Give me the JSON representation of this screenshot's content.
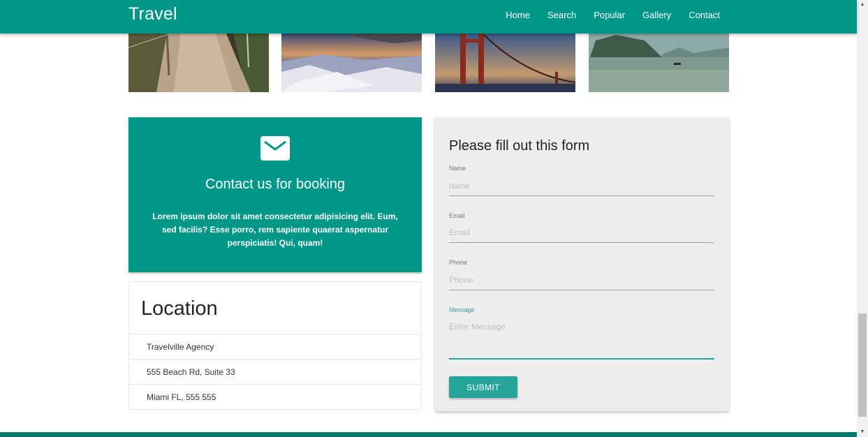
{
  "navbar": {
    "brand": "Travel",
    "links": [
      "Home",
      "Search",
      "Popular",
      "Gallery",
      "Contact"
    ]
  },
  "gallery": {
    "images": [
      "path-through-field-photo",
      "airplane-wing-over-snow-mountains-photo",
      "golden-gate-bridge-sunset-photo",
      "bay-with-limestone-islands-photo"
    ]
  },
  "contact": {
    "icon": "envelope-icon",
    "title": "Contact us for booking",
    "text": "Lorem ipsum dolor sit amet consectetur adipisicing elit. Eum, sed facilis? Esse porro, rem sapiente quaerat aspernatur perspiciatis! Qui, quam!"
  },
  "location": {
    "title": "Location",
    "lines": [
      "Travelville Agency",
      "555 Beach Rd, Suite 33",
      "Miami FL, 555 555"
    ]
  },
  "form": {
    "title": "Please fill out this form",
    "fields": [
      {
        "label": "Name",
        "placeholder": "name",
        "value": ""
      },
      {
        "label": "Email",
        "placeholder": "Email",
        "value": ""
      },
      {
        "label": "Phone",
        "placeholder": "Phone",
        "value": ""
      },
      {
        "label": "Message",
        "placeholder": "Enter Message",
        "value": ""
      }
    ],
    "submit_label": "SUBMIT"
  },
  "colors": {
    "primary": "#009688",
    "accent": "#26a69a",
    "footer": "#00796b"
  }
}
